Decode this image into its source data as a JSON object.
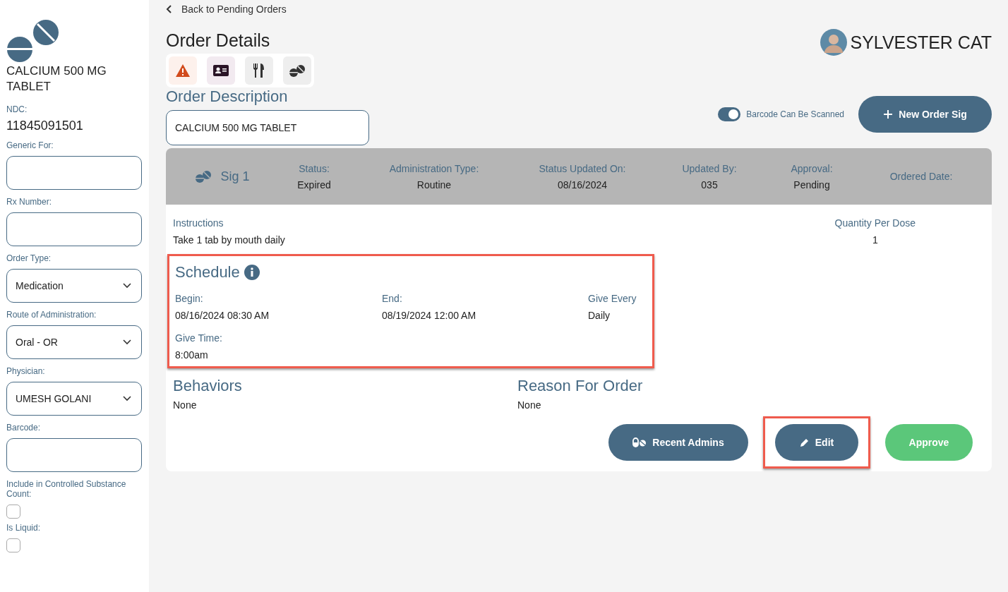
{
  "sidebar": {
    "title": "CALCIUM 500 MG TABLET",
    "fields": [
      {
        "kind": "text",
        "label": "NDC:",
        "value": "11845091501"
      },
      {
        "kind": "input",
        "label": "Generic For:"
      },
      {
        "kind": "input",
        "label": "Rx Number:"
      },
      {
        "kind": "select",
        "label": "Order Type:",
        "value": "Medication"
      },
      {
        "kind": "select",
        "label": "Route of Administration:",
        "value": "Oral - OR"
      },
      {
        "kind": "select",
        "label": "Physician:",
        "value": "UMESH GOLANI"
      },
      {
        "kind": "input",
        "label": "Barcode:"
      },
      {
        "kind": "checkbox",
        "label": "Include in Controlled Substance Count:",
        "checked": false
      },
      {
        "kind": "checkbox",
        "label": "Is Liquid:",
        "checked": false
      }
    ]
  },
  "back_link": "Back to Pending Orders",
  "title": "Order Details",
  "patient": {
    "name": "SYLVESTER CAT"
  },
  "toolbar": [
    {
      "kind": "alert"
    },
    {
      "kind": "id-card"
    },
    {
      "kind": "dining"
    },
    {
      "kind": "pills"
    }
  ],
  "order_description": {
    "label": "Order Description",
    "value": "CALCIUM 500 MG TABLET"
  },
  "barcode_toggle": {
    "label": "Barcode Can Be Scanned",
    "on": true
  },
  "new_order_sig_button": "New Order Sig",
  "sig": {
    "name": "Sig 1",
    "columns": [
      {
        "label": "Status:",
        "value": "Expired"
      },
      {
        "label": "Administration Type:",
        "value": "Routine"
      },
      {
        "label": "Status Updated On:",
        "value": "08/16/2024"
      },
      {
        "label": "Updated By:",
        "value": "035"
      },
      {
        "label": "Approval:",
        "value": "Pending"
      },
      {
        "label": "Ordered Date:"
      }
    ],
    "instructions": {
      "label": "Instructions",
      "value": "Take 1 tab by mouth daily"
    },
    "quantity": {
      "label": "Quantity Per Dose",
      "value": "1"
    },
    "schedule": {
      "title": "Schedule",
      "highlighted": true,
      "fields": [
        {
          "label": "Begin:",
          "value": "08/16/2024 08:30 AM"
        },
        {
          "label": "End:",
          "value": "08/19/2024 12:00 AM"
        },
        {
          "label": "Give Every",
          "value": "Daily"
        },
        {
          "label": "Give Time:",
          "value": "8:00am"
        }
      ]
    },
    "behaviors": {
      "label": "Behaviors",
      "value": "None"
    },
    "reason": {
      "label": "Reason For Order",
      "value": "None"
    },
    "buttons": [
      {
        "kind": "recent",
        "label": "Recent Admins",
        "highlighted": false
      },
      {
        "kind": "edit",
        "label": "Edit",
        "highlighted": true
      },
      {
        "kind": "approve",
        "label": "Approve",
        "highlighted": false
      }
    ]
  }
}
